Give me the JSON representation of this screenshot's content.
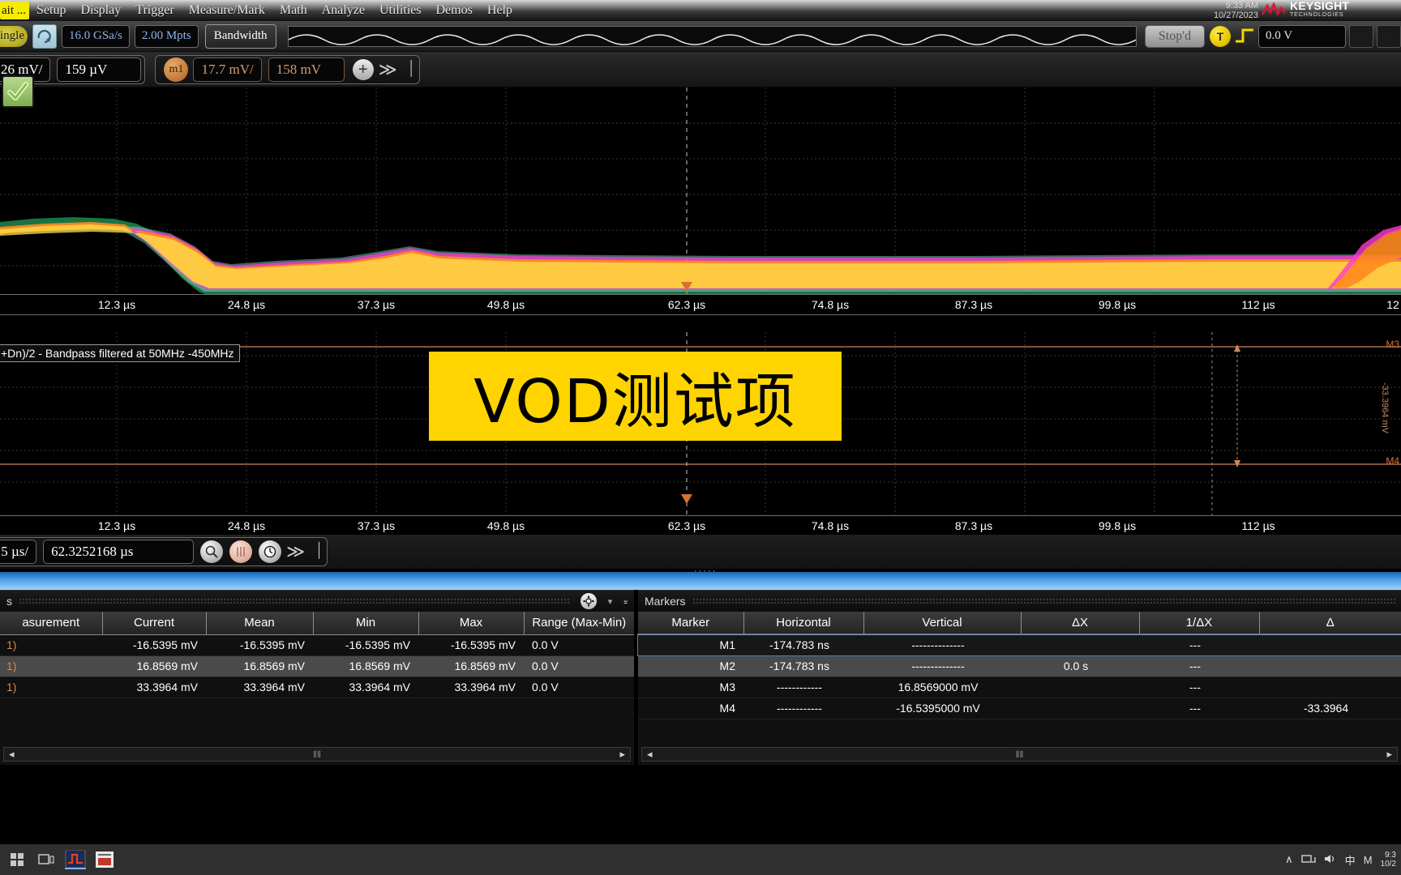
{
  "menubar": {
    "status_chip": "ait ...",
    "items": [
      "Setup",
      "Display",
      "Trigger",
      "Measure/Mark",
      "Math",
      "Analyze",
      "Utilities",
      "Demos",
      "Help"
    ],
    "clock_time": "9:33 AM",
    "clock_date": "10/27/2023",
    "brand_main": "KEYSIGHT",
    "brand_sub": "TECHNOLOGIES"
  },
  "acq_bar": {
    "mode_chip": "ingle",
    "refresh_icon": "refresh-arrow-icon",
    "sample_rate": "16.0 GSa/s",
    "memory_depth": "2.00 Mpts",
    "bandwidth_label": "Bandwidth",
    "run_state": "Stop'd",
    "trigger_badge": "T",
    "trigger_level": "0.0 V"
  },
  "vertical_bar": {
    "ch_scale": "26 mV/",
    "ch_offset": "159 µV",
    "math_badge": "m1",
    "math_scale": "17.7 mV/",
    "math_offset": "158 mV",
    "add_label": "+",
    "more_label": "≫",
    "pin_label": "⏐"
  },
  "waveform": {
    "channel_check_icon": "checkmark-icon",
    "channel_label": "+Dn)/2",
    "math_label": "+Dn)/2 - Bandpass filtered at 50MHz -450MHz",
    "overlay_text": "VOD测试项",
    "time_ticks": [
      "12.3 µs",
      "24.8 µs",
      "37.3 µs",
      "49.8 µs",
      "62.3 µs",
      "74.8 µs",
      "87.3 µs",
      "99.8 µs",
      "112 µs",
      "12"
    ],
    "marker_m3_label": "M3",
    "marker_m4_label": "M4",
    "marker_delta_label": "-33.3964 mV"
  },
  "timebase_bar": {
    "time_scale": ".5 µs/",
    "time_position": "62.3252168 µs",
    "zoom_icon": "zoom-icon",
    "segment_icon": "segments-icon",
    "clock_icon": "clock-icon",
    "more_label": "≫",
    "pin_label": "⏐"
  },
  "measurements": {
    "title": "s",
    "gear_icon": "gear-icon",
    "columns": [
      "asurement",
      "Current",
      "Mean",
      "Min",
      "Max",
      "Range (Max-Min)"
    ],
    "rows": [
      {
        "name": "1)",
        "current": "-16.5395 mV",
        "mean": "-16.5395 mV",
        "min": "-16.5395 mV",
        "max": "-16.5395 mV",
        "range": "0.0 V"
      },
      {
        "name": "1)",
        "current": "16.8569 mV",
        "mean": "16.8569 mV",
        "min": "16.8569 mV",
        "max": "16.8569 mV",
        "range": "0.0 V"
      },
      {
        "name": "1)",
        "current": "33.3964 mV",
        "mean": "33.3964 mV",
        "min": "33.3964 mV",
        "max": "33.3964 mV",
        "range": "0.0 V"
      }
    ],
    "scroll_grip": "‖‖"
  },
  "markers": {
    "title": "Markers",
    "columns": [
      "Marker",
      "Horizontal",
      "Vertical",
      "ΔX",
      "1/ΔX",
      "Δ"
    ],
    "rows": [
      {
        "marker": "M1",
        "horizontal": "-174.783 ns",
        "vertical": "--------------",
        "dx": "",
        "invdx": "---",
        "dy": ""
      },
      {
        "marker": "M2",
        "horizontal": "-174.783 ns",
        "vertical": "--------------",
        "dx": "0.0 s",
        "invdx": "---",
        "dy": ""
      },
      {
        "marker": "M3",
        "horizontal": "------------",
        "vertical": "16.8569000 mV",
        "dx": "",
        "invdx": "---",
        "dy": ""
      },
      {
        "marker": "M4",
        "horizontal": "------------",
        "vertical": "-16.5395000 mV",
        "dx": "",
        "invdx": "---",
        "dy": "-33.3964"
      }
    ],
    "scroll_grip": "‖‖"
  },
  "taskbar": {
    "start_icon": "windows-start-icon",
    "task_icon_1": "scope-app-icon",
    "task_icon_2": "chart-app-icon",
    "tray_chevron": "∧",
    "tray_network_icon": "network-icon",
    "tray_volume_icon": "volume-icon",
    "tray_ime": "中",
    "tray_lang": "M",
    "tray_time": "9:3",
    "tray_date": "10/2"
  },
  "colors": {
    "accent_blue": "#4ea3e8",
    "overlay_yellow": "#ffd400",
    "marker_orange": "#d9702f",
    "status_yellow": "#f5ec00",
    "math_amber": "#d79a6a"
  }
}
